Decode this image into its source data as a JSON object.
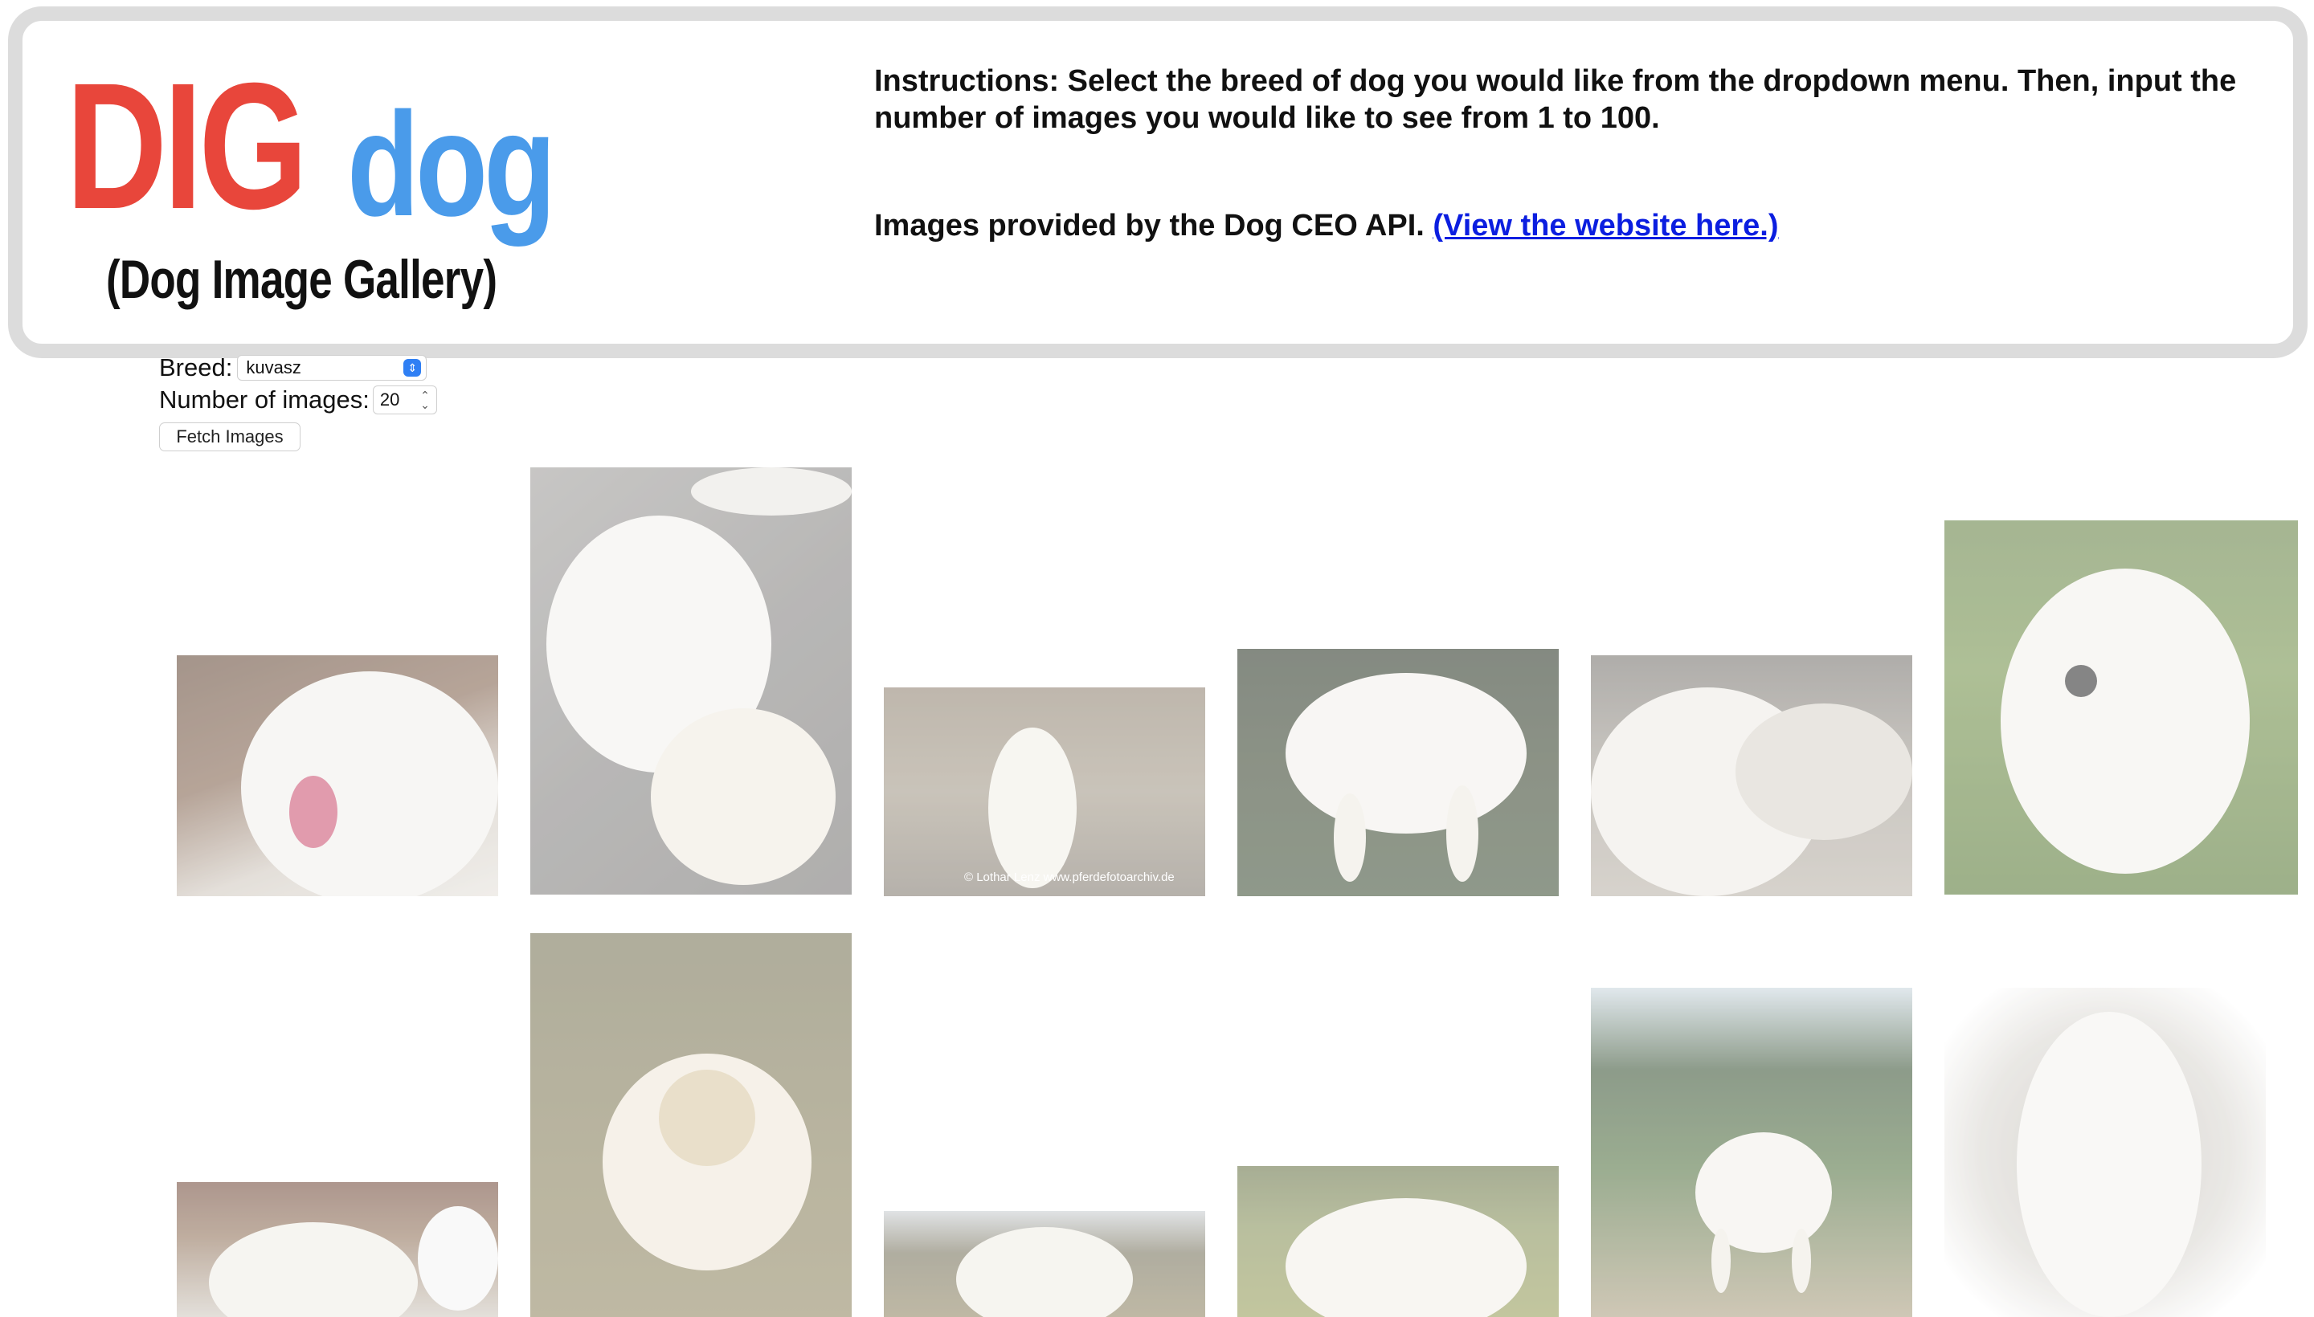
{
  "header": {
    "logo_dig": "DIG",
    "logo_dog": "dog",
    "logo_subtitle": "(Dog Image Gallery)",
    "instructions": "Instructions: Select the breed of dog you would like from the dropdown menu. Then, input the number of images you would like to see from 1 to 100.",
    "credit_text": "Images provided by the Dog CEO API.",
    "credit_link": "(View the website here.)"
  },
  "controls": {
    "breed_label": "Breed:",
    "breed_value": "kuvasz",
    "count_label": "Number of images:",
    "count_value": "20",
    "fetch_button": "Fetch Images"
  },
  "gallery": {
    "images": [
      {
        "id": "img-1",
        "photo_text": ""
      },
      {
        "id": "img-2",
        "photo_text": ""
      },
      {
        "id": "img-3",
        "photo_text": "© Lothar Lenz  www.pferdefotoarchiv.de"
      },
      {
        "id": "img-4",
        "photo_text": ""
      },
      {
        "id": "img-5",
        "photo_text": ""
      },
      {
        "id": "img-6",
        "photo_text": ""
      },
      {
        "id": "img-7",
        "photo_text": ""
      },
      {
        "id": "img-8",
        "photo_text": ""
      },
      {
        "id": "img-9",
        "photo_text": ""
      },
      {
        "id": "img-10",
        "photo_text": ""
      },
      {
        "id": "img-11",
        "photo_text": ""
      },
      {
        "id": "img-12",
        "photo_text": ""
      }
    ]
  },
  "colors": {
    "logo_red": "#e8463b",
    "logo_blue": "#4a9bea",
    "link_blue": "#0b1ee0",
    "header_border": "#dcdcdc"
  }
}
